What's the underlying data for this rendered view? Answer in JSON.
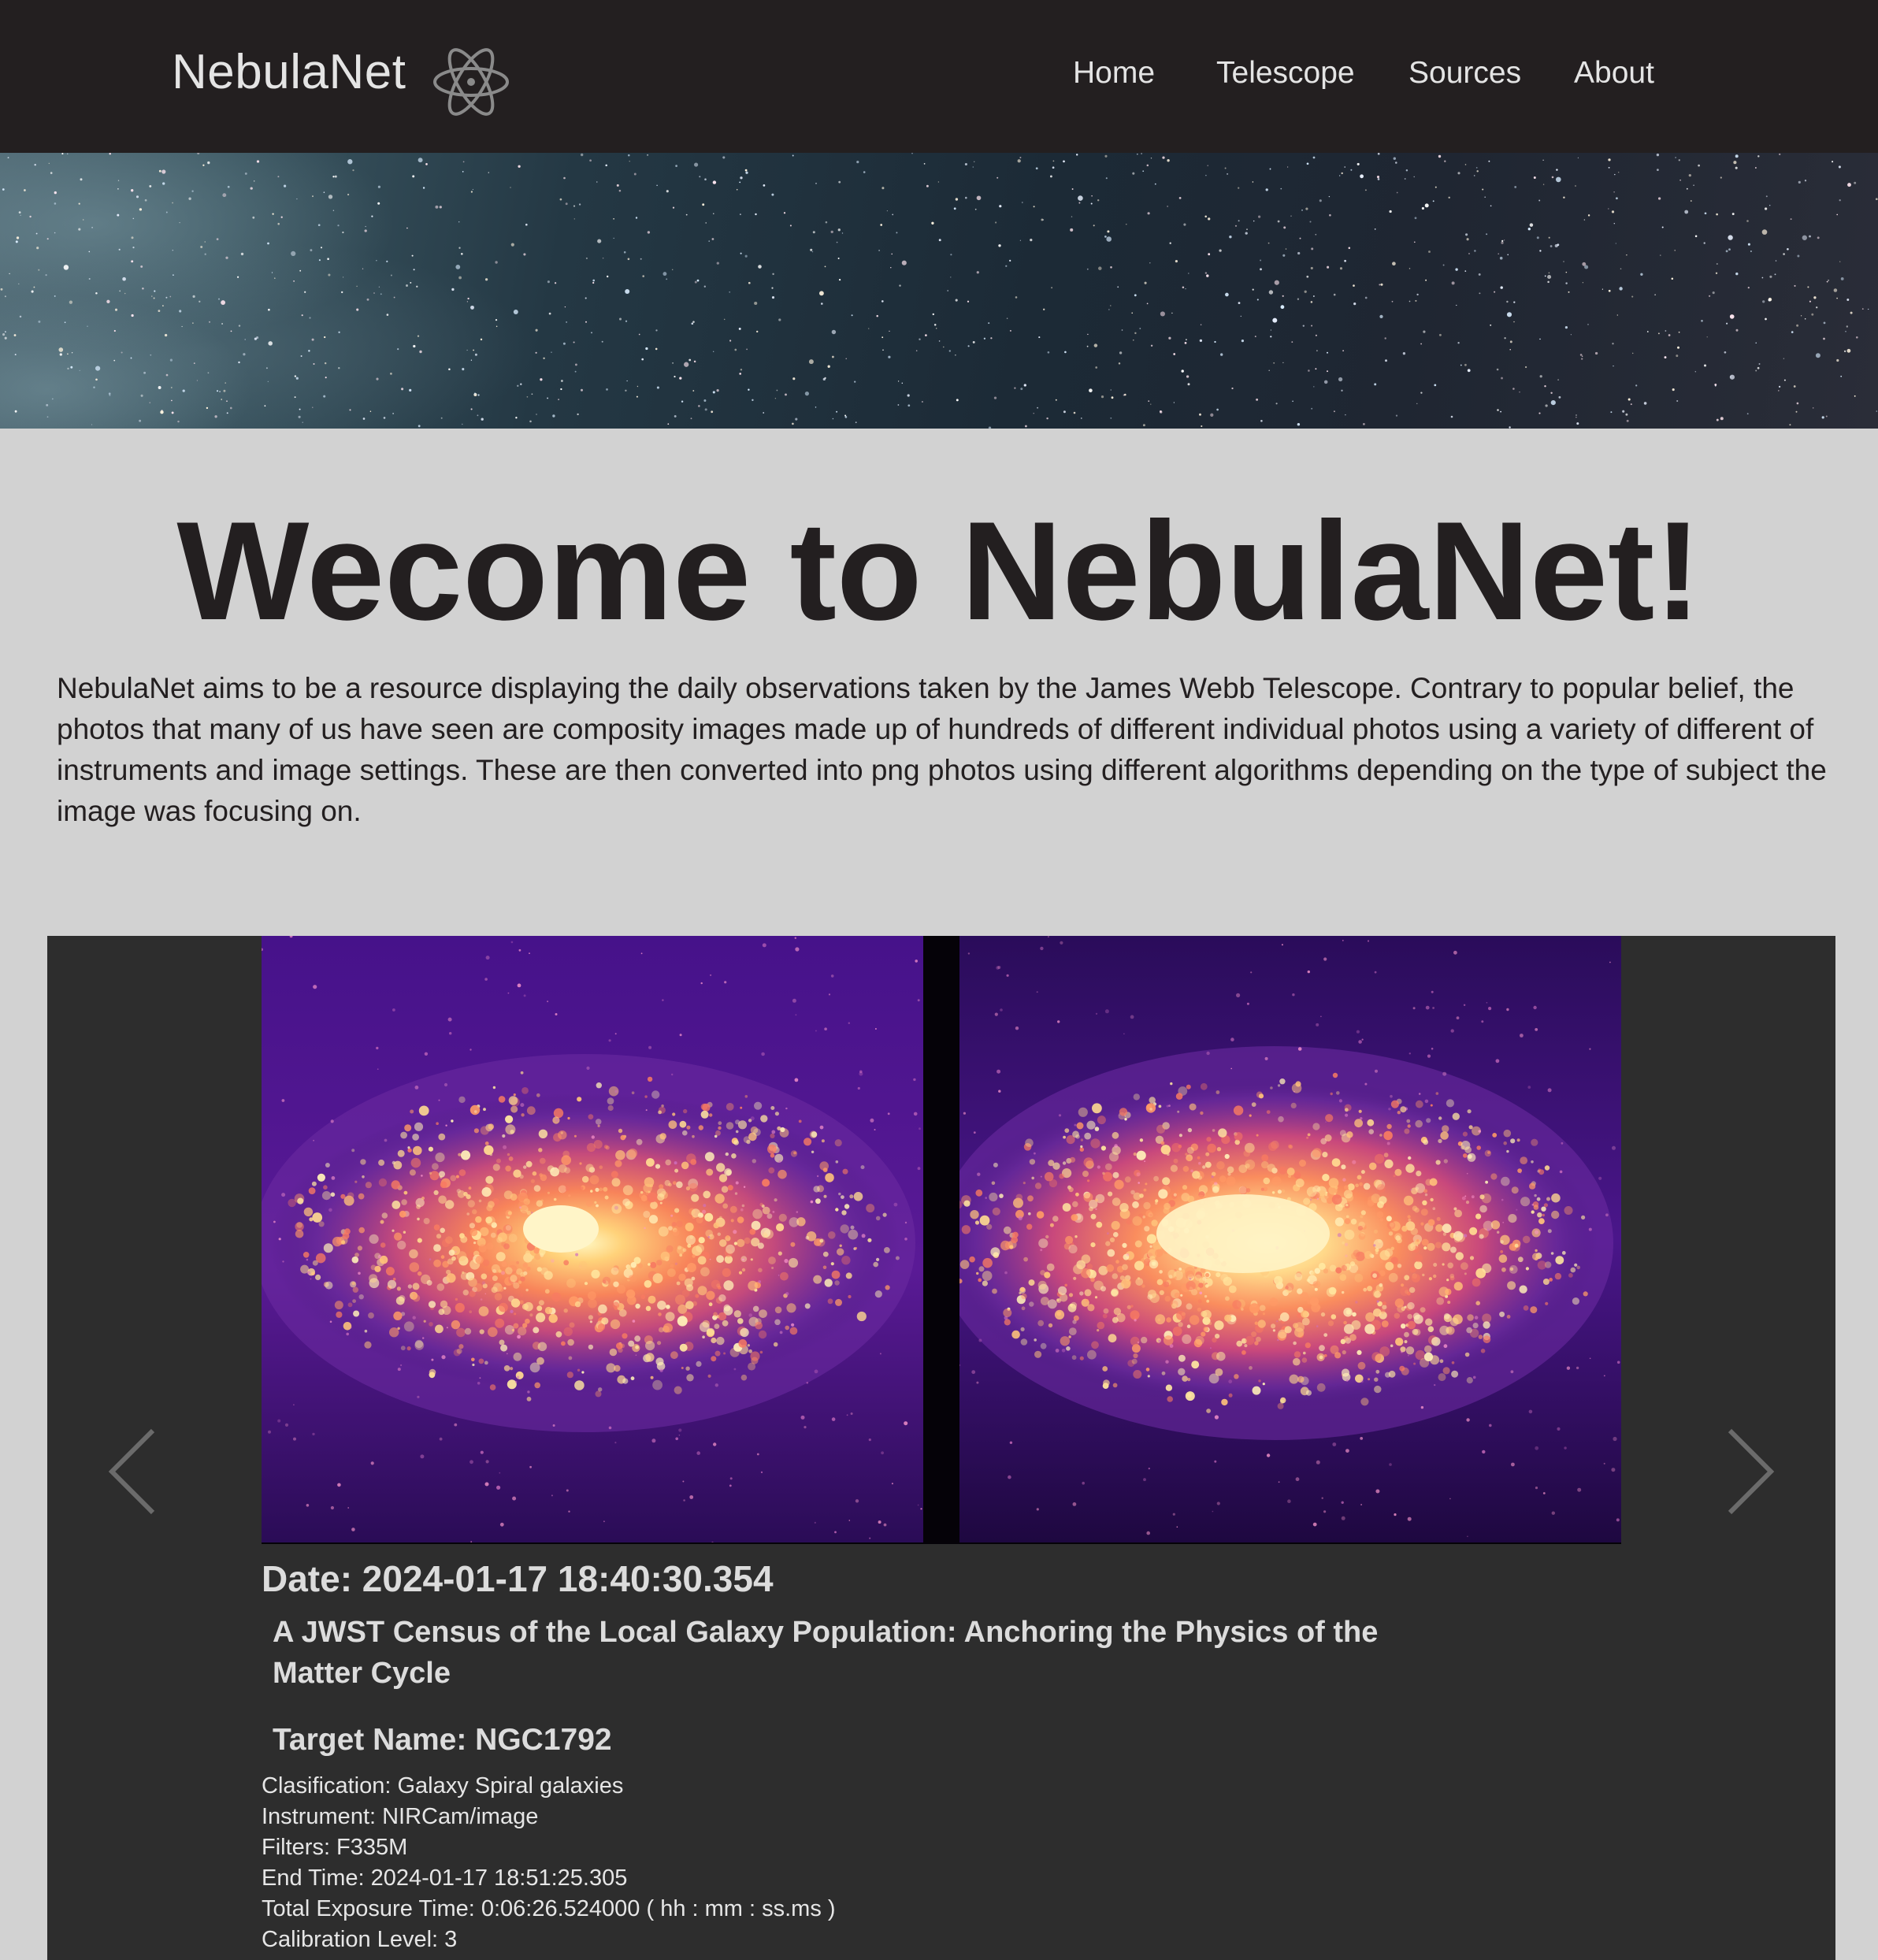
{
  "navbar": {
    "brand": "NebulaNet",
    "logo_icon": "atom-icon",
    "links": [
      {
        "label": "Home"
      },
      {
        "label": "Telescope"
      },
      {
        "label": "Sources"
      },
      {
        "label": "About"
      }
    ]
  },
  "hero": {
    "image": "starfield-banner"
  },
  "intro": {
    "headline": "Wecome to NebulaNet!",
    "paragraph": "NebulaNet aims to be a resource displaying the daily observations taken by the James Webb Telescope. Contrary to popular belief, the photos that many of us have seen are composity images made up of hundreds of different individual photos using a variety of different of instruments and image settings. These are then converted into png photos using different algorithms depending on the type of subject the image was focusing on."
  },
  "carousel": {
    "prev_icon": "chevron-left-icon",
    "next_icon": "chevron-right-icon",
    "images": [
      "spiral-galaxy-image-left",
      "spiral-galaxy-image-right"
    ],
    "date": "Date: 2024-01-17 18:40:30.354",
    "title": "A JWST Census of the Local Galaxy Population: Anchoring the Physics of the Matter Cycle",
    "target": "Target Name: NGC1792",
    "details": {
      "classification": "Clasification: Galaxy Spiral galaxies",
      "instrument": "Instrument: NIRCam/image",
      "filters": "Filters: F335M",
      "end_time": "End Time: 2024-01-17 18:51:25.305",
      "exposure": "Total Exposure Time: 0:06:26.524000 ( hh : mm : ss.ms )",
      "calibration": "Calibration Level: 3"
    }
  },
  "colors": {
    "navbar_bg": "#231f20",
    "page_bg": "#d2d2d2",
    "carousel_bg": "#2d2d2d",
    "headline": "#231f20"
  }
}
